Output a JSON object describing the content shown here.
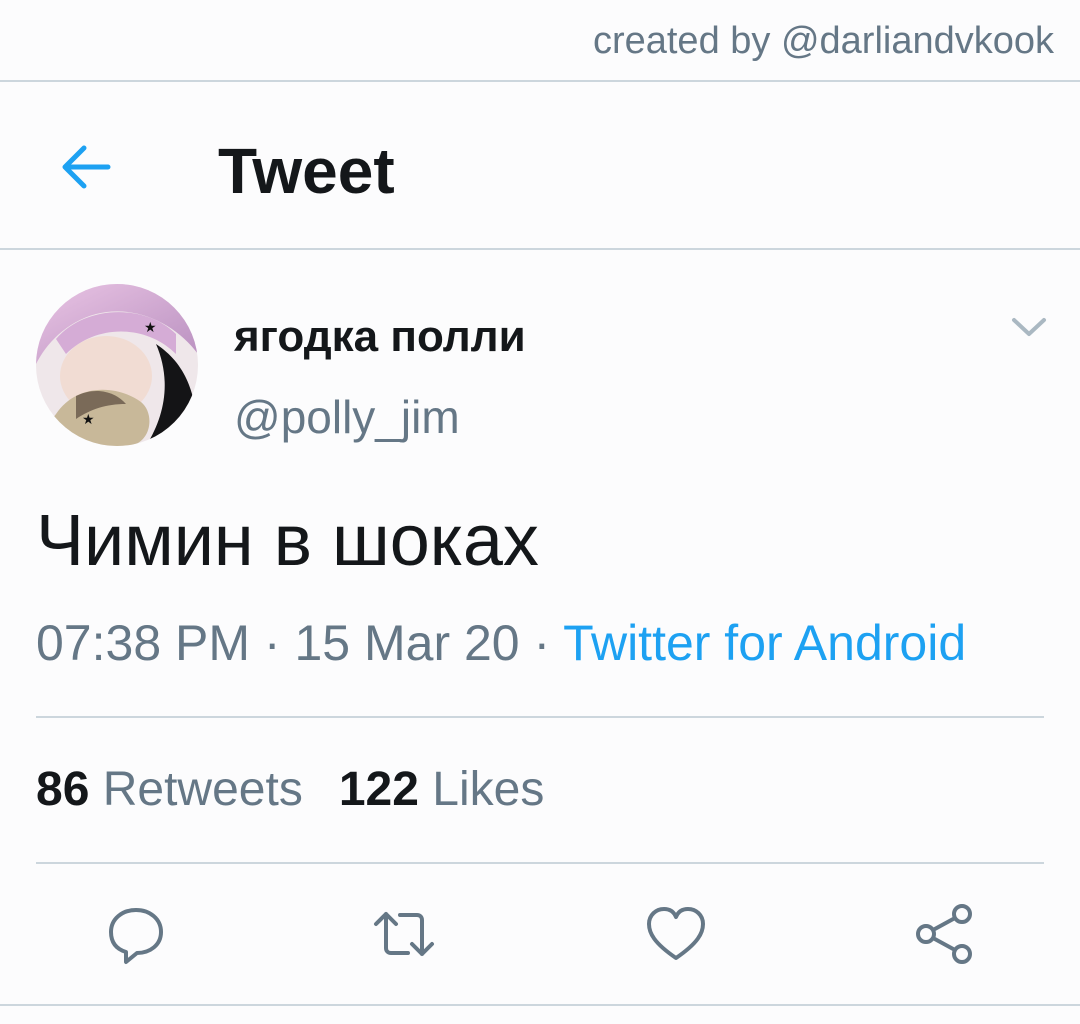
{
  "watermark": "created by @darliandvkook",
  "header": {
    "back_icon": "arrow-left-icon",
    "title": "Tweet"
  },
  "tweet": {
    "display_name": "ягодка полли",
    "handle": "@polly_jim",
    "text": "Чимин в шоках",
    "time": "07:38 PM",
    "separator": "·",
    "date": "15 Mar 20",
    "source": "Twitter for Android",
    "retweets_count": "86",
    "retweets_label": "Retweets",
    "likes_count": "122",
    "likes_label": "Likes"
  },
  "actions": [
    {
      "icon": "reply-icon"
    },
    {
      "icon": "retweet-icon"
    },
    {
      "icon": "heart-icon"
    },
    {
      "icon": "share-icon"
    }
  ],
  "colors": {
    "accent": "#1da1f2",
    "text": "#14171a",
    "secondary": "#657786",
    "divider": "#ccd6dd"
  }
}
